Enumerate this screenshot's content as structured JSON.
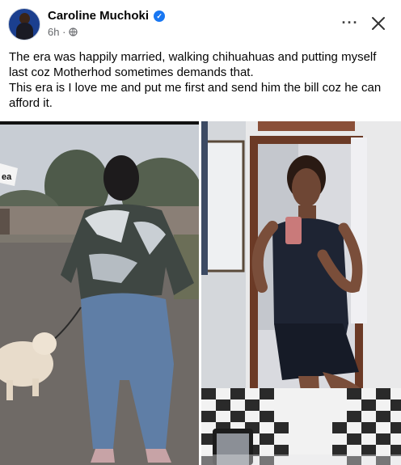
{
  "post": {
    "author": "Caroline Muchoki",
    "time": "6h",
    "separator": "·",
    "audience_icon": "globe-icon",
    "verified_icon": "verified-badge-icon",
    "text_lines": [
      "The era was happily married, walking chihuahuas and putting myself last coz Motherhod sometimes demands that.",
      "This era is I love me and put me first and send him the bill coz he can afford it."
    ],
    "left_photo_sticker": "ea"
  },
  "actions": {
    "more_icon": "more-options-icon",
    "more_label": "···",
    "close_icon": "close-icon"
  },
  "colors": {
    "verified_blue": "#1877f2",
    "meta_gray": "#65676b",
    "text": "#050505"
  }
}
